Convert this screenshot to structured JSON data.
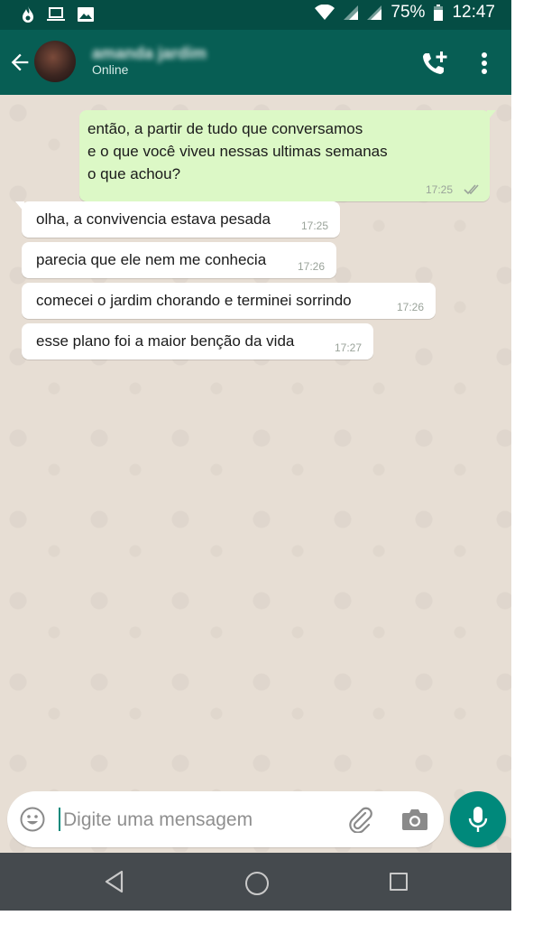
{
  "status_bar": {
    "battery_percent": "75%",
    "time": "12:47",
    "icons": [
      "fire-notification-icon",
      "laptop-icon",
      "image-icon",
      "wifi-icon",
      "signal-icon",
      "signal-icon",
      "battery-icon"
    ]
  },
  "header": {
    "contact_name": "amanda jardim",
    "contact_status": "Online",
    "icons": [
      "back-arrow-icon",
      "add-call-icon",
      "more-vert-icon"
    ]
  },
  "messages": [
    {
      "direction": "out",
      "text": "então, a partir de tudo que conversamos\ne o que você viveu nessas ultimas semanas\no que achou?",
      "time": "17:25",
      "status": "read"
    },
    {
      "direction": "in",
      "text": "olha, a convivencia estava pesada",
      "time": "17:25"
    },
    {
      "direction": "in",
      "text": "parecia que ele nem me conhecia",
      "time": "17:26"
    },
    {
      "direction": "in",
      "text": "comecei o jardim chorando e terminei sorrindo",
      "time": "17:26"
    },
    {
      "direction": "in",
      "text": "esse plano foi a maior benção da vida",
      "time": "17:27"
    }
  ],
  "composer": {
    "placeholder": "Digite uma mensagem",
    "value": ""
  },
  "colors": {
    "header": "#075e54",
    "status_bar": "#054d44",
    "outgoing_bubble": "#dcf8c6",
    "incoming_bubble": "#ffffff",
    "chat_background": "#e7ded4",
    "accent": "#00897b",
    "read_ticks": "#9aa39a",
    "nav_bar": "#454a4e"
  }
}
